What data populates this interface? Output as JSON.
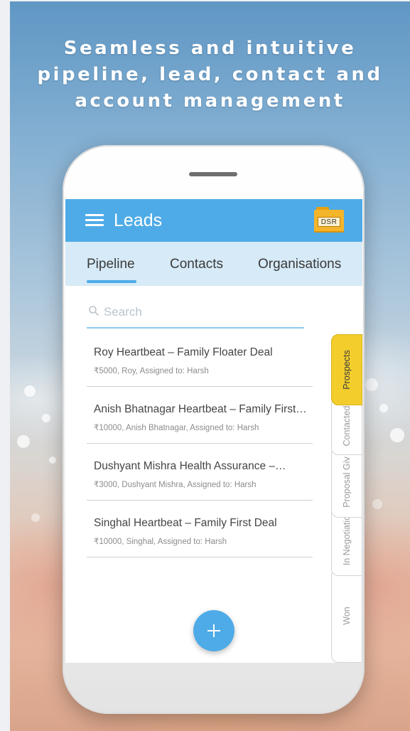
{
  "headline": {
    "line1": "Seamless and intuitive",
    "line2": "pipeline, lead, contact and",
    "line3": "account management"
  },
  "app": {
    "title": "Leads",
    "menu_icon": "hamburger-menu-icon",
    "dsr_label": "DSR",
    "dsr_icon": "folder-icon",
    "accent_color": "#4eabe7",
    "active_stage_color": "#f2cd2c"
  },
  "tabs": [
    {
      "label": "Pipeline",
      "active": true
    },
    {
      "label": "Contacts",
      "active": false
    },
    {
      "label": "Organisations",
      "active": false
    }
  ],
  "search": {
    "placeholder": "Search",
    "icon": "search-icon"
  },
  "leads": [
    {
      "title": "Roy Heartbeat – Family Floater Deal",
      "subtitle": "₹5000, Roy, Assigned to: Harsh"
    },
    {
      "title": "Anish Bhatnagar Heartbeat – Family First…",
      "subtitle": "₹10000, Anish Bhatnagar, Assigned to: Harsh"
    },
    {
      "title": "Dushyant Mishra Health Assurance –…",
      "subtitle": "₹3000, Dushyant Mishra, Assigned to: Harsh"
    },
    {
      "title": "Singhal Heartbeat – Family First Deal",
      "subtitle": "₹10000, Singhal, Assigned to: Harsh"
    }
  ],
  "stages": [
    {
      "label": "Prospects",
      "active": true
    },
    {
      "label": "Contacted",
      "active": false
    },
    {
      "label": "Proposal Giv",
      "active": false
    },
    {
      "label": "In Negotiatio",
      "active": false
    },
    {
      "label": "Won",
      "active": false
    }
  ],
  "fab": {
    "icon": "plus-icon"
  }
}
